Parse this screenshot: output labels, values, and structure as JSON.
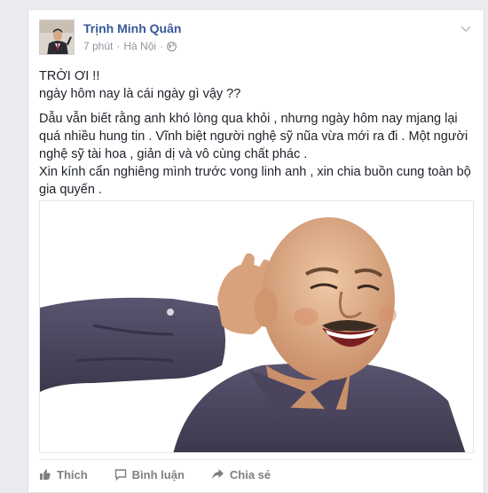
{
  "post": {
    "author": "Trịnh Minh Quân",
    "time": "7 phút",
    "separator": "·",
    "location": "Hà Nội",
    "privacy_icon": "globe-icon",
    "lines": [
      "TRỜI ƠI !!",
      "ngày hôm nay là cái ngày gì vậy ??",
      "Dẫu vẫn biết rằng anh khó lòng qua khỏi , nhưng ngày hôm nay mjang lại quá nhiều hung tin . Vĩnh biệt người nghệ sỹ nũa vừa mới ra đi . Một người nghệ sỹ tài hoa , giản dị và vô cùng chất phác .",
      "Xin kính cẩn nghiêng mình trước vong linh anh , xin chia buồn cung toàn bộ gia quyến ."
    ]
  },
  "actions": {
    "like": "Thích",
    "comment": "Bình luận",
    "share": "Chia sẻ"
  },
  "colors": {
    "author_link": "#365899",
    "meta_text": "#90949c",
    "body_text": "#1d2129",
    "action_text": "#7f7f7f",
    "shirt": "#4d4860"
  }
}
